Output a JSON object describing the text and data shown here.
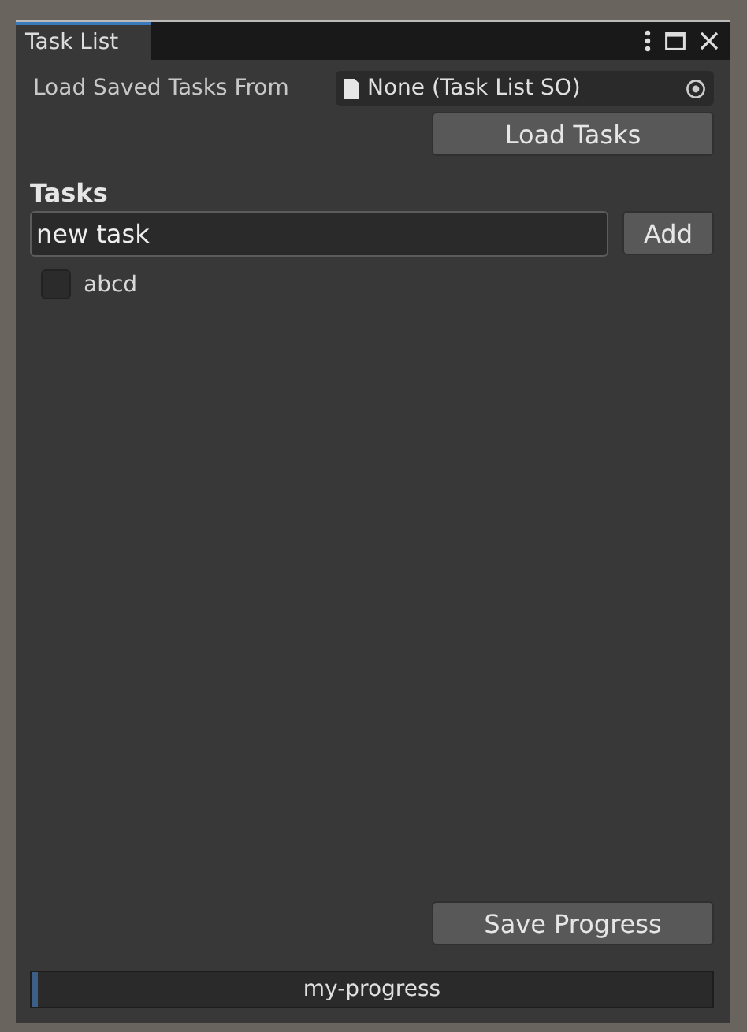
{
  "window": {
    "tab": "Task List"
  },
  "source": {
    "label": "Load Saved Tasks From",
    "value": "None (Task List SO)"
  },
  "load_button": "Load Tasks",
  "tasks": {
    "heading": "Tasks",
    "input": {
      "value": "new task"
    },
    "add_button": "Add",
    "items": [
      {
        "label": "abcd",
        "checked": false
      }
    ]
  },
  "save_button": "Save Progress",
  "progress": {
    "label": "my-progress",
    "level": 0.01
  }
}
